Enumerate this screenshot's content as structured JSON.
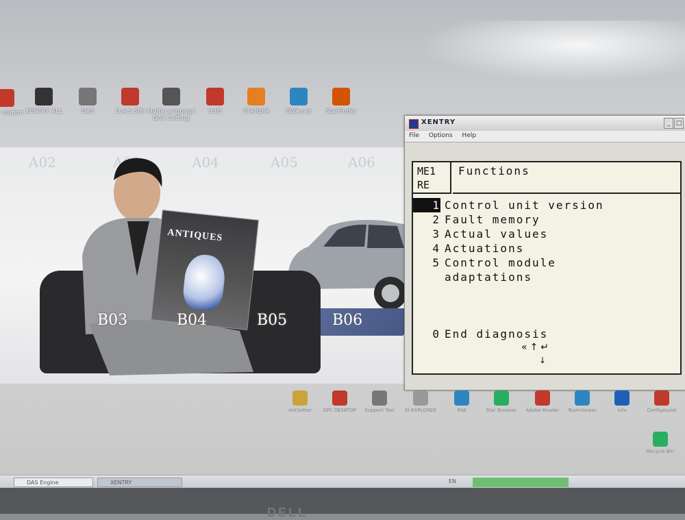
{
  "desktop": {
    "top_icons": [
      {
        "label": "ntry ulation",
        "icon": "app-icon",
        "color": "#c0392b"
      },
      {
        "label": "XENTRY ALL",
        "icon": "xentry-icon",
        "color": "#333333"
      },
      {
        "label": "DAS",
        "icon": "das-icon",
        "color": "#777777"
      },
      {
        "label": "D.A.S SIM",
        "icon": "das-sim-icon",
        "color": "#c0392b"
      },
      {
        "label": "Multi-Language DAS Setting",
        "icon": "mercedes-star-icon",
        "color": "#555555"
      },
      {
        "label": "Vdi3",
        "icon": "vdi3-icon",
        "color": "#c0392b"
      },
      {
        "label": "STARDIA",
        "icon": "stardia-icon",
        "color": "#e67e22"
      },
      {
        "label": "EWA.net",
        "icon": "ewa-icon",
        "color": "#2e86c1"
      },
      {
        "label": "StarFinder",
        "icon": "starfinder-icon",
        "color": "#d35400"
      }
    ],
    "wallpaper": {
      "stall_labels": [
        "A02",
        "A03",
        "A04",
        "A05",
        "A06"
      ],
      "bay_labels": [
        "B03",
        "B04",
        "B05",
        "B06"
      ],
      "magazine_title": "ANTIQUES"
    },
    "lower_icons": [
      {
        "label": "HotSetter",
        "icon": "key-icon",
        "color": "#caa43a"
      },
      {
        "label": "EPC DESKTOP",
        "icon": "cube-icon",
        "color": "#c0392b"
      },
      {
        "label": "Support Tool",
        "icon": "tool-icon",
        "color": "#777777"
      },
      {
        "label": "SI-EXPLORER",
        "icon": "si-icon",
        "color": "#999999"
      },
      {
        "label": "PAB",
        "icon": "pab-icon",
        "color": "#2e86c1"
      },
      {
        "label": "Star Browser",
        "icon": "globe-icon",
        "color": "#27ae60"
      },
      {
        "label": "Adobe Reader",
        "icon": "pdf-icon",
        "color": "#c0392b"
      },
      {
        "label": "TeamViewer",
        "icon": "teamviewer-icon",
        "color": "#2e86c1"
      },
      {
        "label": "Info",
        "icon": "info-icon",
        "color": "#1f5fb8"
      },
      {
        "label": "ConfigAssist",
        "icon": "config-icon",
        "color": "#c0392b"
      },
      {
        "label": "Recycle Bin",
        "icon": "recycle-bin-icon",
        "color": "#27ae60"
      }
    ]
  },
  "das_window": {
    "title": "XENTRY",
    "menu": [
      "File",
      "Options",
      "Help"
    ],
    "header_left": [
      "ME1",
      "RE"
    ],
    "header_title": "Functions",
    "items": [
      {
        "num": "1",
        "label": "Control unit version",
        "selected": true
      },
      {
        "num": "2",
        "label": "Fault memory",
        "selected": false
      },
      {
        "num": "3",
        "label": "Actual values",
        "selected": false
      },
      {
        "num": "4",
        "label": "Actuations",
        "selected": false
      },
      {
        "num": "5",
        "label": "Control module",
        "selected": false
      },
      {
        "num": "",
        "label": "adaptations",
        "selected": false
      }
    ],
    "end_item": {
      "num": "0",
      "label": "End diagnosis"
    },
    "nav_hint": "«↑↵",
    "nav_down": "↓"
  },
  "taskbar": {
    "buttons": [
      "DAS Engine",
      "XENTRY"
    ],
    "tray": "EN"
  },
  "monitor_brand": "DELL"
}
